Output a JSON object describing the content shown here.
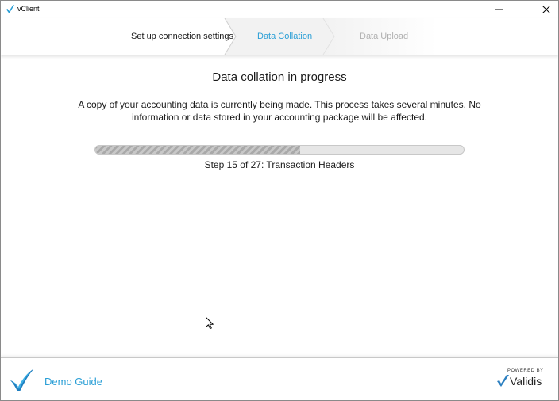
{
  "window": {
    "title": "vClient"
  },
  "steps": [
    {
      "label": "Set up connection settings",
      "state": "completed"
    },
    {
      "label": "Data Collation",
      "state": "active"
    },
    {
      "label": "Data Upload",
      "state": "pending"
    }
  ],
  "main": {
    "heading": "Data collation in progress",
    "description": "A copy of your accounting data is currently being made. This process takes several minutes. No information or data stored in your accounting package will be affected.",
    "progress": {
      "current_step": 15,
      "total_steps": 27,
      "fraction": 0.556,
      "status_text": "Step 15 of 27: Transaction Headers"
    }
  },
  "footer": {
    "link_label": "Demo Guide",
    "powered_by": "POWERED BY",
    "brand_name": "Validis"
  },
  "icons": {
    "app": "vclient-check-icon",
    "minimize": "minimize-icon",
    "maximize": "maximize-icon",
    "close": "close-icon",
    "footer_logo": "vclient-logo-icon",
    "brand_logo": "validis-check-icon",
    "cursor": "mouse-cursor-icon"
  },
  "colors": {
    "accent": "#2b9fd6",
    "step_pending": "#b0b0b0",
    "step_active_bg": "#f2f2f2",
    "progress_fill": "#b5b5b5",
    "progress_track": "#e6e6e6"
  }
}
